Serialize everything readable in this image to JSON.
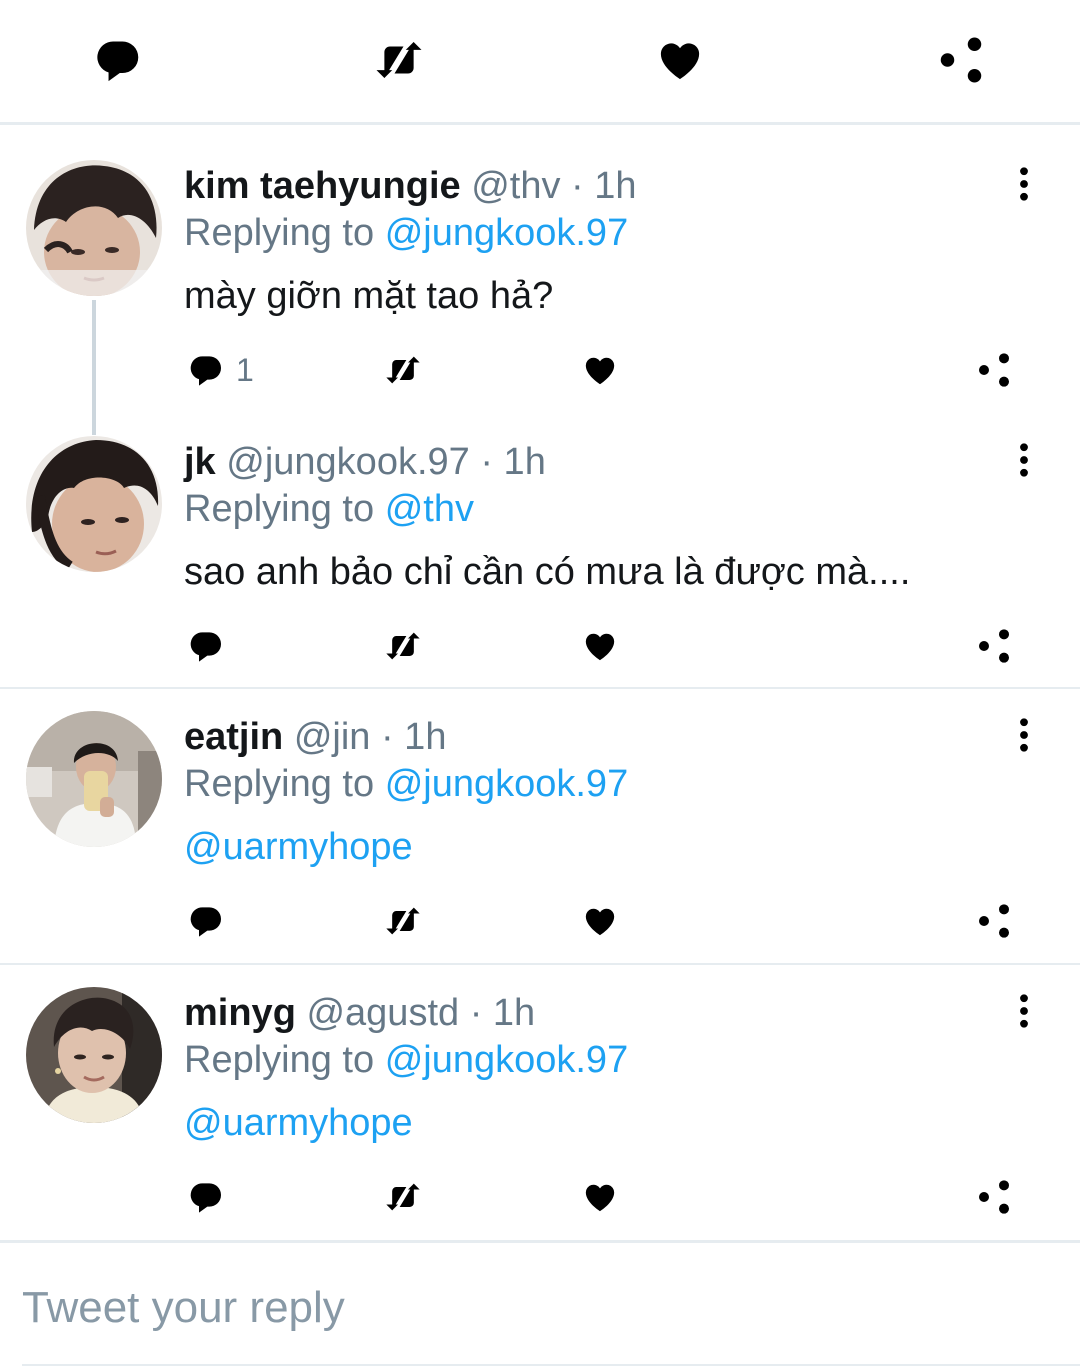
{
  "top_actions": {
    "reply_icon": "reply-icon",
    "retweet_icon": "retweet-icon",
    "like_icon": "like-icon",
    "share_icon": "share-icon"
  },
  "tweets": [
    {
      "display_name": "kim taehyungie",
      "handle": "@thv",
      "time": "· 1h",
      "replying_prefix": "Replying to",
      "replying_to": "@jungkook.97",
      "text": "mày giỡn mặt tao hả?",
      "reply_count": "1"
    },
    {
      "display_name": "jk",
      "handle": "@jungkook.97",
      "time": "· 1h",
      "replying_prefix": "Replying to",
      "replying_to": "@thv",
      "text": "sao anh bảo chỉ cần có mưa là được mà....",
      "reply_count": ""
    },
    {
      "display_name": "eatjin",
      "handle": "@jin",
      "time": "· 1h",
      "replying_prefix": "Replying to",
      "replying_to": "@jungkook.97",
      "text": "@uarmyhope",
      "reply_count": ""
    },
    {
      "display_name": "minyg",
      "handle": "@agustd",
      "time": "· 1h",
      "replying_prefix": "Replying to",
      "replying_to": "@jungkook.97",
      "text": "@uarmyhope",
      "reply_count": ""
    }
  ],
  "reply_box": {
    "placeholder": "Tweet your reply"
  },
  "colors": {
    "accent": "#1da1f2",
    "text": "#14171a",
    "muted": "#657786",
    "divider": "#e6ecf0"
  }
}
